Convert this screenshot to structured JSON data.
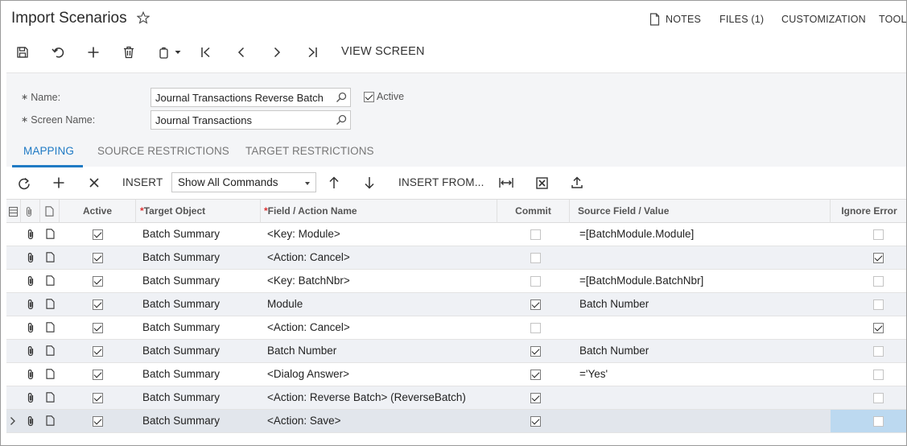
{
  "header": {
    "title": "Import Scenarios",
    "nav": [
      {
        "id": "notes",
        "label": "NOTES"
      },
      {
        "id": "files",
        "label": "FILES (1)"
      },
      {
        "id": "customization",
        "label": "CUSTOMIZATION"
      },
      {
        "id": "tools",
        "label": "TOOLS"
      }
    ]
  },
  "toolbar": {
    "icons": [
      "save-icon",
      "undo-icon",
      "add-icon",
      "delete-icon",
      "copy-paste-icon",
      "first-record-icon",
      "previous-record-icon",
      "next-record-icon",
      "last-record-icon"
    ],
    "view_screen": "VIEW SCREEN"
  },
  "form": {
    "name_label": "Name:",
    "name_value": "Journal Transactions Reverse Batch",
    "screen_label": "Screen Name:",
    "screen_value": "Journal Transactions",
    "active_label": "Active",
    "active_checked": true
  },
  "tabs": [
    {
      "label": "MAPPING",
      "active": true
    },
    {
      "label": "SOURCE RESTRICTIONS",
      "active": false
    },
    {
      "label": "TARGET RESTRICTIONS",
      "active": false
    }
  ],
  "grid_toolbar": {
    "insert": "INSERT",
    "command_filter": "Show All Commands",
    "insert_from": "INSERT FROM..."
  },
  "grid": {
    "columns": {
      "active": "Active",
      "target_object": "Target Object",
      "field_action": "Field / Action Name",
      "commit": "Commit",
      "source": "Source Field / Value",
      "ignore_error": "Ignore Error"
    },
    "rows": [
      {
        "active": true,
        "target": "Batch Summary",
        "field": "<Key: Module>",
        "commit": false,
        "source": "=[BatchModule.Module]",
        "ignore": false
      },
      {
        "active": true,
        "target": "Batch Summary",
        "field": "<Action: Cancel>",
        "commit": false,
        "source": "",
        "ignore": true
      },
      {
        "active": true,
        "target": "Batch Summary",
        "field": "<Key: BatchNbr>",
        "commit": false,
        "source": "=[BatchModule.BatchNbr]",
        "ignore": false
      },
      {
        "active": true,
        "target": "Batch Summary",
        "field": "Module",
        "commit": true,
        "source": "Batch Number",
        "ignore": false
      },
      {
        "active": true,
        "target": "Batch Summary",
        "field": "<Action: Cancel>",
        "commit": false,
        "source": "",
        "ignore": true
      },
      {
        "active": true,
        "target": "Batch Summary",
        "field": "Batch Number",
        "commit": true,
        "source": "Batch Number",
        "ignore": false
      },
      {
        "active": true,
        "target": "Batch Summary",
        "field": "<Dialog Answer>",
        "commit": true,
        "source": "='Yes'",
        "ignore": false
      },
      {
        "active": true,
        "target": "Batch Summary",
        "field": "<Action: Reverse Batch> (ReverseBatch)",
        "commit": true,
        "source": "",
        "ignore": false
      },
      {
        "active": true,
        "target": "Batch Summary",
        "field": "<Action: Save>",
        "commit": true,
        "source": "",
        "ignore": false,
        "selected": true
      }
    ]
  }
}
